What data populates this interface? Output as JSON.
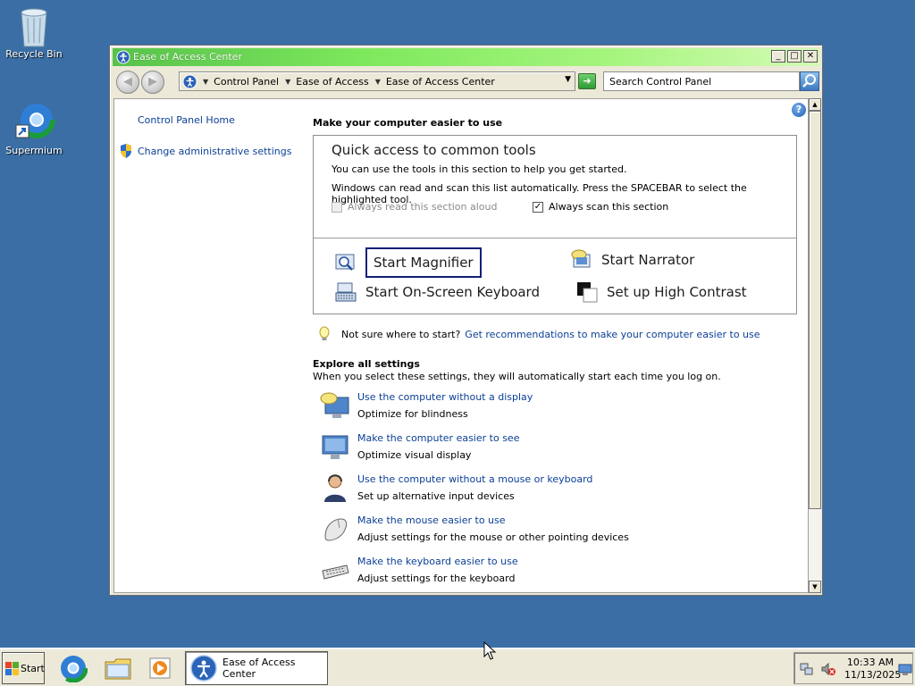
{
  "desktop": {
    "icons": [
      {
        "label": "Recycle Bin",
        "icon": "recycle-bin-icon"
      },
      {
        "label": "Supermium",
        "icon": "supermium-browser-icon"
      }
    ]
  },
  "window": {
    "title": "Ease of Access Center",
    "controls": {
      "minimize": "_",
      "maximize": "□",
      "close": "✕"
    },
    "breadcrumb": [
      "Control Panel",
      "Ease of Access",
      "Ease of Access Center"
    ],
    "search_placeholder": "Search Control Panel"
  },
  "sidebar": {
    "home_link": "Control Panel Home",
    "admin_link": "Change administrative settings"
  },
  "main": {
    "heading": "Make your computer easier to use",
    "quick_access": {
      "title": "Quick access to common tools",
      "desc1": "You can use the tools in this section to help you get started.",
      "desc2": "Windows can read and scan this list automatically.  Press the SPACEBAR to select the highlighted tool.",
      "read_aloud_label": "Always read this section aloud",
      "read_aloud_checked": false,
      "read_aloud_enabled": false,
      "scan_label": "Always scan this section",
      "scan_checked": true,
      "tools": {
        "magnifier": "Start Magnifier",
        "narrator": "Start Narrator",
        "keyboard": "Start On-Screen Keyboard",
        "contrast": "Set up High Contrast"
      }
    },
    "hint_text": "Not sure where to start?",
    "hint_link": "Get recommendations to make your computer easier to use",
    "explore": {
      "heading": "Explore all settings",
      "desc": "When you select these settings, they will automatically start each time you log on.",
      "settings": [
        {
          "link": "Use the computer without a display",
          "desc": "Optimize for blindness",
          "icon": "monitor-speech-icon"
        },
        {
          "link": "Make the computer easier to see",
          "desc": "Optimize visual display",
          "icon": "monitor-icon"
        },
        {
          "link": "Use the computer without a mouse or keyboard",
          "desc": "Set up alternative input devices",
          "icon": "person-headset-icon"
        },
        {
          "link": "Make the mouse easier to use",
          "desc": "Adjust settings for the mouse or other pointing devices",
          "icon": "mouse-icon"
        },
        {
          "link": "Make the keyboard easier to use",
          "desc": "Adjust settings for the keyboard",
          "icon": "keyboard-icon"
        }
      ]
    }
  },
  "taskbar": {
    "start_label": "Start",
    "quick_launch": [
      "supermium-icon",
      "file-explorer-icon",
      "media-player-icon"
    ],
    "task_label": "Ease of Access Center",
    "time": "10:33 AM",
    "date": "11/13/2025",
    "tray_icons": [
      "network-icon",
      "volume-muted-icon",
      "display-icon"
    ]
  },
  "colors": {
    "desktop": "#3a6ea5",
    "title_gradient_start": "#57c24b",
    "link": "#0b3f96",
    "window_face": "#ece9d8"
  }
}
